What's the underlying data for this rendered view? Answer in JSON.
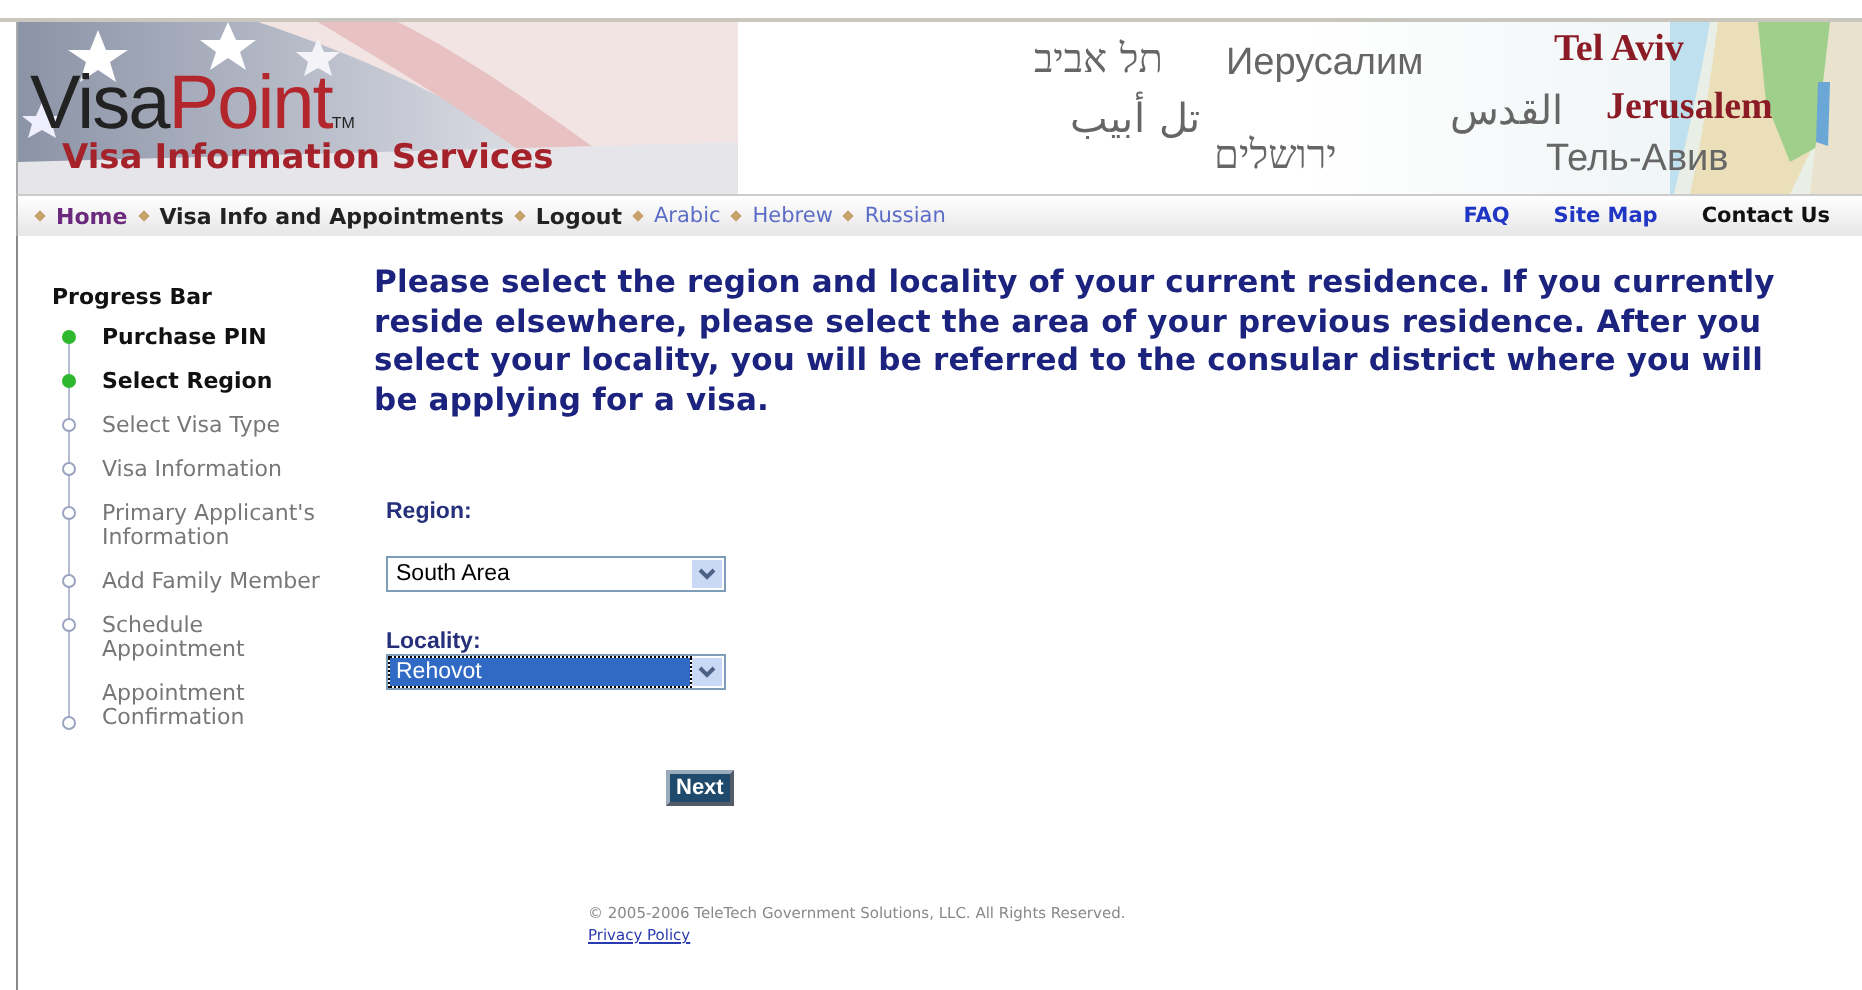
{
  "banner": {
    "brand_dark": "Visa",
    "brand_accent": "Point",
    "trademark": "TM",
    "subtitle": "Visa Information Services",
    "city_names": [
      {
        "text": "תל אביב",
        "kind": "hebrew"
      },
      {
        "text": "Иерусалим",
        "kind": "russian"
      },
      {
        "text": "Tel Aviv",
        "kind": "english"
      },
      {
        "text": "تل أبيب",
        "kind": "arabic"
      },
      {
        "text": "القدس",
        "kind": "arabic"
      },
      {
        "text": "Jerusalem",
        "kind": "english"
      },
      {
        "text": "ירושלים",
        "kind": "hebrew"
      },
      {
        "text": "Тель-Авив",
        "kind": "russian"
      }
    ]
  },
  "nav": {
    "links": [
      {
        "label": "Home",
        "kind": "main",
        "visited": true
      },
      {
        "label": "Visa Info and Appointments",
        "kind": "main",
        "visited": false
      },
      {
        "label": "Logout",
        "kind": "main",
        "visited": false
      },
      {
        "label": "Arabic",
        "kind": "language",
        "visited": false
      },
      {
        "label": "Hebrew",
        "kind": "language",
        "visited": false
      },
      {
        "label": "Russian",
        "kind": "language",
        "visited": false
      }
    ],
    "right_links": [
      {
        "label": "FAQ",
        "visited": false
      },
      {
        "label": "Site Map",
        "visited": false
      },
      {
        "label": "Contact Us",
        "visited": true
      }
    ]
  },
  "progress": {
    "title": "Progress Bar",
    "steps": [
      {
        "label": "Purchase PIN",
        "done": true
      },
      {
        "label": "Select Region",
        "done": true
      },
      {
        "label": "Select Visa Type",
        "done": false
      },
      {
        "label": "Visa Information",
        "done": false
      },
      {
        "label": "Primary Applicant's Information",
        "done": false
      },
      {
        "label": "Add Family Member",
        "done": false
      },
      {
        "label": "Schedule Appointment",
        "done": false
      },
      {
        "label": "Appointment Confirmation",
        "done": false
      }
    ]
  },
  "instructions": "Please select the region and locality of your current residence. If you currently reside elsewhere, please select the area of your previous residence. After you select your locality, you will be referred to the consular district where you will be applying for a visa.",
  "form": {
    "fields": [
      {
        "label": "Region:",
        "value": "South Area",
        "focused": false
      },
      {
        "label": "Locality:",
        "value": "Rehovot",
        "focused": true
      }
    ],
    "submit": "Next"
  },
  "footer": {
    "copyright": "© 2005-2006 TeleTech Government Solutions, LLC. All Rights Reserved.",
    "privacy_link": "Privacy Policy"
  }
}
